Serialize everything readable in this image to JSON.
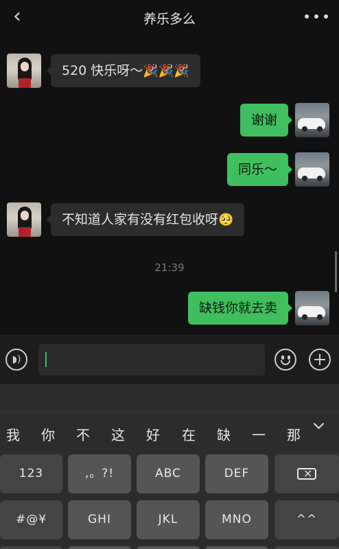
{
  "header": {
    "back_label": "‹",
    "title": "养乐多么",
    "more_icon": "more-dots-icon"
  },
  "chat": {
    "messages": [
      {
        "from": "contact",
        "text": "520 快乐呀～",
        "emoji": "🎉🎉🎉"
      },
      {
        "from": "me",
        "text": "谢谢"
      },
      {
        "from": "me",
        "text": "同乐～"
      },
      {
        "from": "contact",
        "text": "不知道人家有没有红包收呀",
        "emoji": "🥺"
      },
      {
        "from": "me",
        "text": "缺钱你就去卖"
      }
    ],
    "timestamp": "21:39"
  },
  "input": {
    "value": "",
    "voice_icon": "voice-icon",
    "emoji_icon": "emoji-icon",
    "add_icon": "plus-icon"
  },
  "keyboard": {
    "candidates": [
      "我",
      "你",
      "不",
      "这",
      "好",
      "在",
      "缺",
      "一",
      "那"
    ],
    "row1": [
      "123",
      ",。?!",
      "ABC",
      "DEF"
    ],
    "row2": [
      "#@¥",
      "GHI",
      "JKL",
      "MNO",
      "^^"
    ]
  },
  "colors": {
    "sent_bubble": "#3fbf5f",
    "received_bubble": "#2c2c2c",
    "background": "#111111"
  }
}
